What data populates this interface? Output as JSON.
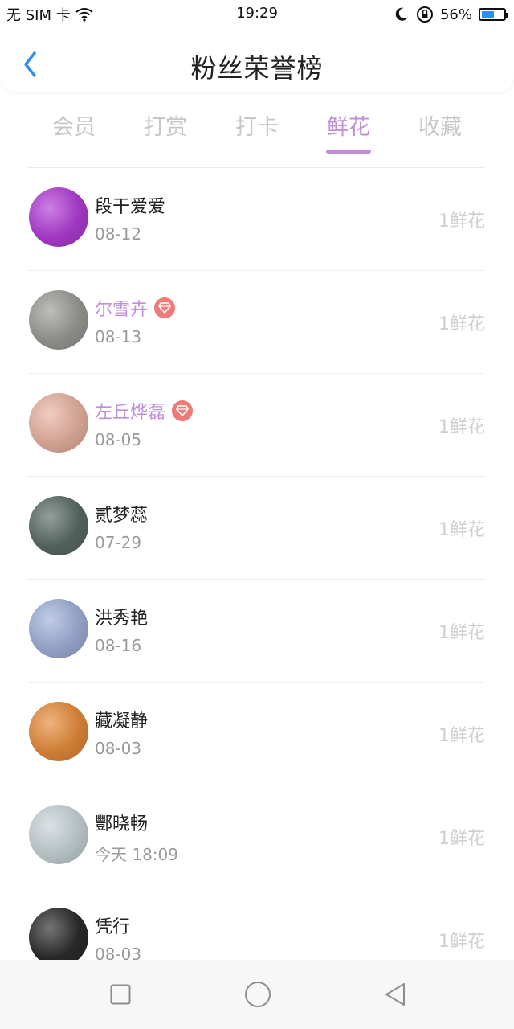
{
  "status_bar": {
    "carrier": "无 SIM 卡",
    "time": "19:29",
    "battery_pct": "56%",
    "battery_level": 0.56,
    "icons": [
      "wifi-icon",
      "moon-icon",
      "rotation-lock-icon",
      "battery-icon"
    ]
  },
  "header": {
    "title": "粉丝荣誉榜",
    "back_icon": "back-chevron-icon"
  },
  "tabs": [
    {
      "label": "会员",
      "active": false
    },
    {
      "label": "打赏",
      "active": false
    },
    {
      "label": "打卡",
      "active": false
    },
    {
      "label": "鲜花",
      "active": true
    },
    {
      "label": "收藏",
      "active": false
    }
  ],
  "list": [
    {
      "name": "段干爱爱",
      "date": "08-12",
      "count": "1鲜花",
      "vip": false,
      "avatar_color": "#b13cd6"
    },
    {
      "name": "尔雪卉",
      "date": "08-13",
      "count": "1鲜花",
      "vip": true,
      "avatar_color": "#9a9a95"
    },
    {
      "name": "左丘烨磊",
      "date": "08-05",
      "count": "1鲜花",
      "vip": true,
      "avatar_color": "#e7b2a0"
    },
    {
      "name": "贰梦蕊",
      "date": "07-29",
      "count": "1鲜花",
      "vip": false,
      "avatar_color": "#5a6b66"
    },
    {
      "name": "洪秀艳",
      "date": "08-16",
      "count": "1鲜花",
      "vip": false,
      "avatar_color": "#9fb0d8"
    },
    {
      "name": "藏凝静",
      "date": "08-03",
      "count": "1鲜花",
      "vip": false,
      "avatar_color": "#e58a3a"
    },
    {
      "name": "酆晓畅",
      "date": "今天 18:09",
      "count": "1鲜花",
      "vip": false,
      "avatar_color": "#c7d2d6"
    },
    {
      "name": "凭行",
      "date": "08-03",
      "count": "1鲜花",
      "vip": false,
      "avatar_color": "#2b2b2b"
    }
  ],
  "nav_bar": {
    "icons": [
      "recent-apps-icon",
      "home-icon",
      "back-icon"
    ]
  },
  "colors": {
    "accent": "#c08fd8",
    "vip_name": "#bf8fd9",
    "vip_badge": "#f07a78",
    "back_blue": "#2e8ff0"
  }
}
